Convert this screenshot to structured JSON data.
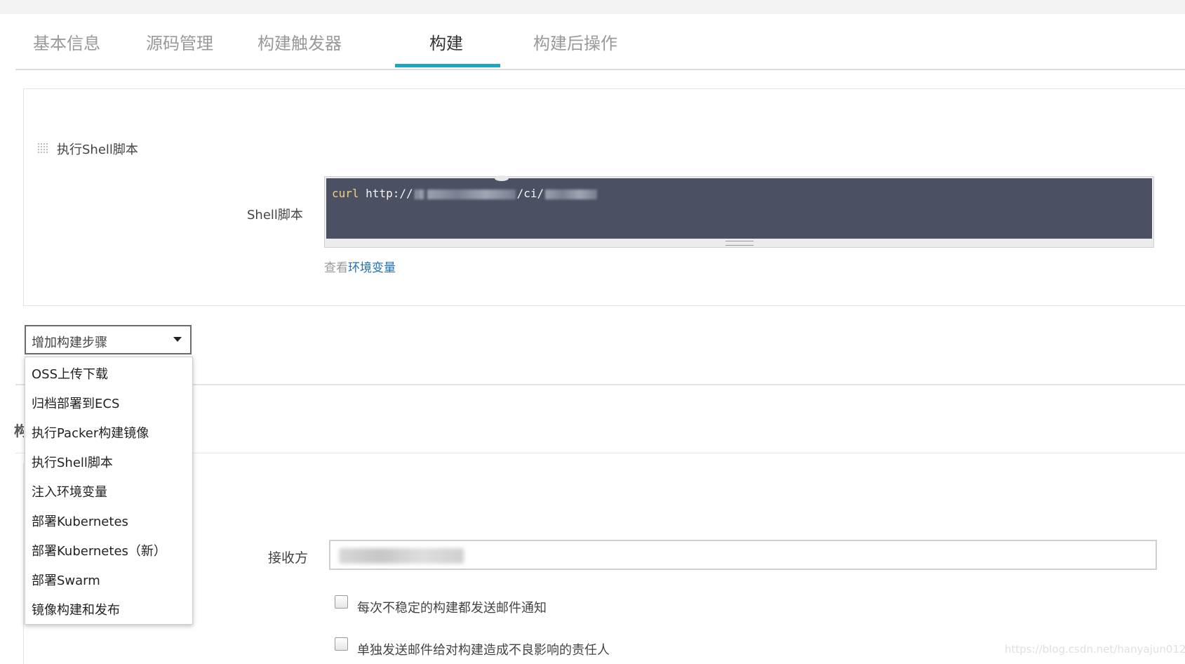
{
  "tabs": [
    {
      "label": "基本信息"
    },
    {
      "label": "源码管理"
    },
    {
      "label": "构建触发器"
    },
    {
      "label": "构建",
      "active": true
    },
    {
      "label": "构建后操作"
    }
  ],
  "accent_color": "#1ba6c5",
  "shell_step": {
    "title": "执行Shell脚本",
    "field_label": "Shell脚本",
    "code_keyword": "curl",
    "code_url_prefix": "http://",
    "code_path_part": "/ci/",
    "env_hint_prefix": "查看",
    "env_hint_link": "环境变量"
  },
  "add_step": {
    "label": "增加构建步骤",
    "options": [
      "OSS上传下载",
      "归档部署到ECS",
      "执行Packer构建镜像",
      "执行Shell脚本",
      "注入环境变量",
      "部署Kubernetes",
      "部署Kubernetes（新）",
      "部署Swarm",
      "镜像构建和发布"
    ]
  },
  "email": {
    "recipients_label": "接收方",
    "checkboxes": [
      {
        "label": "每次不稳定的构建都发送邮件通知",
        "checked": false
      },
      {
        "label": "单独发送邮件给对构建造成不良影响的责任人",
        "checked": false
      }
    ]
  },
  "section_title_partial": "构",
  "watermark": "https://blog.csdn.net/hanyajun0123"
}
